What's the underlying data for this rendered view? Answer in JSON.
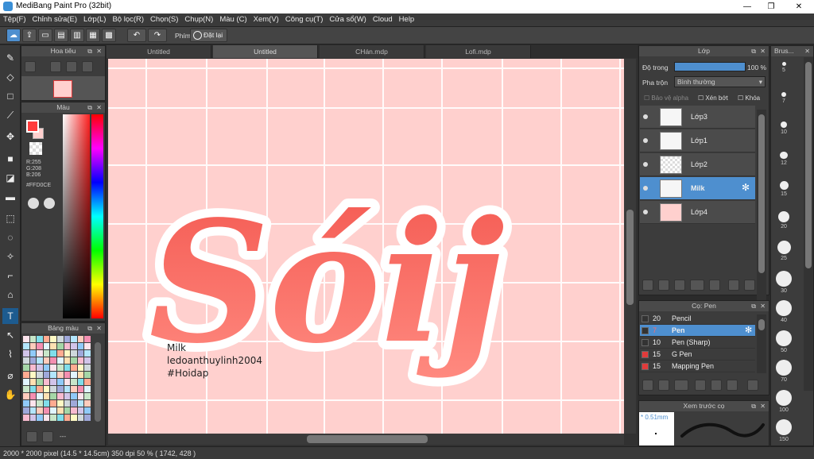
{
  "app": {
    "title": "MediBang Paint Pro (32bit)"
  },
  "window_controls": {
    "minimize": "—",
    "maximize": "❐",
    "close": "✕"
  },
  "menu": [
    "Tệp(F)",
    "Chỉnh sửa(E)",
    "Lớp(L)",
    "Bộ lọc(R)",
    "Chọn(S)",
    "Chụp(N)",
    "Màu (C)",
    "Xem(V)",
    "Công cụ(T)",
    "Cửa sổ(W)",
    "Cloud",
    "Help"
  ],
  "toolbar": {
    "phim_label": "Phím",
    "reset_label": "Đặt lại"
  },
  "tabs": [
    "Untitled",
    "Untitled",
    "CHán.mdp",
    "Lofi.mdp"
  ],
  "navigator": {
    "title": "Hoa tiêu"
  },
  "color_panel": {
    "title": "Màu",
    "r": "R:255",
    "g": "G:208",
    "b": "B:206",
    "hex": "#FFD0CE",
    "primary": "#ff3b3b",
    "secondary": "#ffd0ce"
  },
  "palette_panel": {
    "title": "Bảng màu",
    "footer": "---"
  },
  "canvas": {
    "bg": "#ffd0ce",
    "big_text": "Sóij",
    "signature": [
      "Milk",
      "ledoanthuylinh2004",
      "#Hoidap"
    ]
  },
  "layers": {
    "title": "Lớp",
    "opacity_label": "Độ trong",
    "opacity_value": "100 %",
    "blend_label": "Pha trộn",
    "blend_value": "Bình thường",
    "protect_alpha": "Bảo vệ alpha",
    "clip": "Xén bớt",
    "lock": "Khóa",
    "items": [
      {
        "name": "Lớp3"
      },
      {
        "name": "Lớp1"
      },
      {
        "name": "Lớp2"
      },
      {
        "name": "Milk"
      },
      {
        "name": "Lớp4"
      }
    ]
  },
  "brush_panel": {
    "title": "Cọ: Pen",
    "items": [
      {
        "size": "20",
        "name": "Pencil",
        "color": "#333333"
      },
      {
        "size": "7",
        "name": "Pen",
        "color": "#333333"
      },
      {
        "size": "10",
        "name": "Pen (Sharp)",
        "color": "#333333"
      },
      {
        "size": "15",
        "name": "G Pen",
        "color": "#e03b3b"
      },
      {
        "size": "15",
        "name": "Mapping Pen",
        "color": "#e03b3b"
      }
    ]
  },
  "preview": {
    "title": "Xem trước cọ",
    "size": "* 0.51mm"
  },
  "brush_sizes": {
    "title": "Brus...",
    "sizes": [
      "5",
      "7",
      "10",
      "12",
      "15",
      "20",
      "25",
      "30",
      "40",
      "50",
      "70",
      "100",
      "150"
    ]
  },
  "status": {
    "text": "2000 * 2000 pixel   (14.5 * 14.5cm)   350 dpi   50 %   ( 1742, 428 )"
  }
}
